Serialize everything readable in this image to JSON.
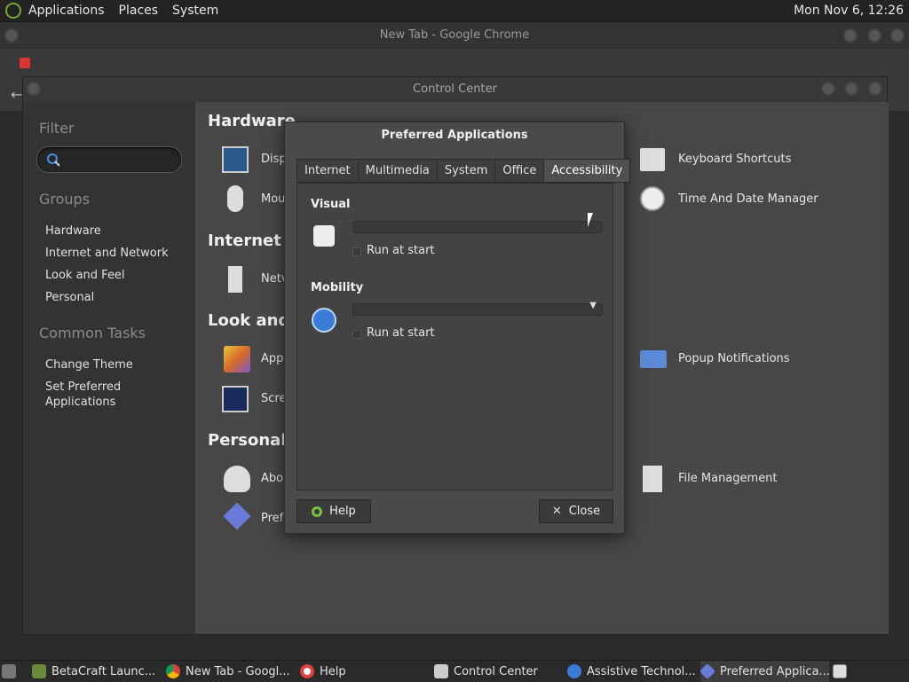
{
  "top_panel": {
    "menus": [
      "Applications",
      "Places",
      "System"
    ],
    "clock": "Mon Nov 6, 12:26"
  },
  "chrome": {
    "title": "New Tab - Google Chrome"
  },
  "control_center": {
    "title": "Control Center",
    "filter_label": "Filter",
    "groups_label": "Groups",
    "groups": [
      "Hardware",
      "Internet and Network",
      "Look and Feel",
      "Personal"
    ],
    "tasks_label": "Common Tasks",
    "tasks": [
      "Change Theme",
      "Set Preferred\nApplications"
    ],
    "sections": {
      "hardware": "Hardware",
      "internet": "Internet ar",
      "look": "Look and F",
      "personal": "Personal"
    },
    "items": {
      "display": "Disp",
      "mouse": "Mou",
      "network": "Netv",
      "appearance": "Appe",
      "screensaver": "Scre",
      "about": "Abou",
      "preferred": "Pref",
      "keyboard_shortcuts": "Keyboard Shortcuts",
      "time_date": "Time And Date Manager",
      "popup_notifications": "Popup Notifications",
      "file_management": "File Management"
    }
  },
  "dialog": {
    "title": "Preferred Applications",
    "tabs": [
      "Internet",
      "Multimedia",
      "System",
      "Office",
      "Accessibility"
    ],
    "active_tab": "Accessibility",
    "visual_label": "Visual",
    "mobility_label": "Mobility",
    "run_at_start": "Run at start",
    "help_button": "Help",
    "close_button": "Close"
  },
  "taskbar": {
    "items": [
      "BetaCraft Launc...",
      "New Tab - Googl...",
      "Help",
      "Control Center",
      "Assistive Technol...",
      "Preferred Applica..."
    ]
  },
  "colors": {
    "accent_blue": "#3a7bd5",
    "panel_bg": "#232323",
    "dialog_bg": "#4a4a4a"
  }
}
